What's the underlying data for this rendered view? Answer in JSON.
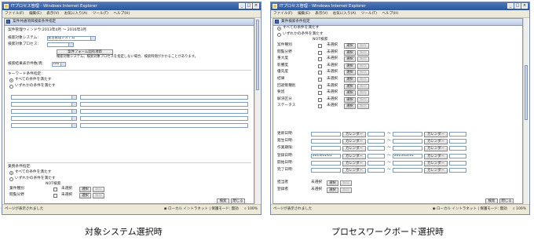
{
  "window": {
    "title": "ITプロセス管理 - Windows Internet Explorer",
    "menu": [
      "ファイル(F)",
      "編集(E)",
      "表示(V)",
      "お気に入り(A)",
      "ツール(T)",
      "ヘルプ(H)"
    ],
    "controls": [
      "_",
      "□",
      "×"
    ]
  },
  "left": {
    "panel_title": "案件共通項目検索条件指定",
    "period": "案件管理ウィンドウ:2013年4月 〜 2016年3月",
    "system_label": "検索対象システム:",
    "system_value": "受注管理システム",
    "process_label": "検索対象プロセス:",
    "unique_button": "案件フォーム固有項目",
    "note": "検索対象システム、検索対象プロセスを指定しない場合、検索時間がかかることがあります。",
    "count_label": "検索結果表示件数/頁:",
    "count_value": "100",
    "keyword_header": "キーワード条件指定:",
    "all_conditions": "すべての条件を満たす",
    "any_condition": "いずれかの条件を満たす",
    "more_header": "業務条件指定:",
    "not_header": "NOT検索",
    "field_rows": [
      {
        "label": "業件種別",
        "unselected": "未選択",
        "select": "選択",
        "clear": "解除"
      },
      {
        "label": "閲覧分野",
        "unselected": "未選択",
        "select": "選択",
        "clear": "解除"
      }
    ],
    "search_button": "検索",
    "close_button": "閉じる",
    "status_left": "ページが表示されました",
    "status_zone": "ローカル イントラネット | 保護モード: 無効",
    "zoom": "100%"
  },
  "right": {
    "panel_title": "業件検索条件指定",
    "all_conditions": "すべての条件を満たす",
    "any_condition": "いずれかの条件を満たす",
    "not_header": "NOT検索",
    "field_rows": [
      {
        "label": "案件種別",
        "unselected": "未選択",
        "select": "選択",
        "clear": "解除"
      },
      {
        "label": "閲覧分野",
        "unselected": "未選択",
        "select": "選択",
        "clear": "解除"
      },
      {
        "label": "重大度",
        "unselected": "未選択",
        "select": "選択",
        "clear": "解除"
      },
      {
        "label": "影響度",
        "unselected": "未選択",
        "select": "選択",
        "clear": "解除"
      },
      {
        "label": "優先度",
        "unselected": "未選択",
        "select": "選択",
        "clear": "解除"
      },
      {
        "label": "結果",
        "unselected": "未選択",
        "select": "選択",
        "clear": "解除"
      },
      {
        "label": "回避策種別",
        "unselected": "未選択",
        "select": "選択",
        "clear": "解除"
      },
      {
        "label": "要因",
        "unselected": "未選択",
        "select": "選択",
        "clear": "解除"
      },
      {
        "label": "解決区分",
        "unselected": "未選択",
        "select": "選択",
        "clear": "解除"
      },
      {
        "label": "ステータス",
        "unselected": "未選択",
        "select": "選択",
        "clear": "解除"
      }
    ],
    "date_rows": [
      {
        "label": "更新日時:",
        "from": "",
        "to": ""
      },
      {
        "label": "発生日時:",
        "from": "",
        "to": ""
      },
      {
        "label": "作業期限:",
        "from": "",
        "to": ""
      },
      {
        "label": "登録日時:",
        "from": "2013/01/01",
        "to": "2015/12/31"
      },
      {
        "label": "開始日時:",
        "from": "",
        "to": ""
      },
      {
        "label": "完了日時:",
        "from": "",
        "to": ""
      }
    ],
    "calendar_button": "カレンダー",
    "tilde": "〜",
    "person_rows": [
      {
        "label": "担当者",
        "unselected": "未選択",
        "select": "選択",
        "clear": "解除"
      },
      {
        "label": "登録者",
        "unselected": "未選択",
        "select": "選択",
        "clear": "解除"
      }
    ],
    "search_button": "検索",
    "close_button": "閉じる",
    "status_left": "ページが表示されました",
    "status_zone": "ローカル イントラネット | 保護モード: 無効",
    "zoom": "100%"
  },
  "captions": {
    "left": "対象システム選択時",
    "right": "プロセスワークボード選択時"
  }
}
